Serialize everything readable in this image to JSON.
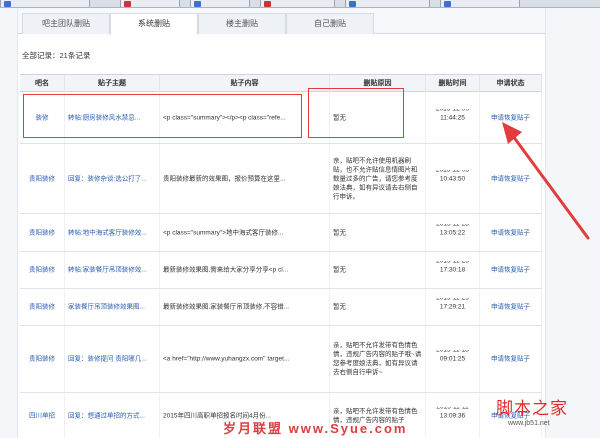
{
  "browser_tabs": [
    "",
    "",
    "",
    "",
    "",
    ""
  ],
  "subtabs": [
    "吧主团队删贴",
    "系统删贴",
    "楼主删贴",
    "自己删贴"
  ],
  "record_count": "全部记录：21条记录",
  "table": {
    "headers": [
      "吧名",
      "贴子主题",
      "贴子内容",
      "删贴原因",
      "删贴时间",
      "申请状态"
    ],
    "rows": [
      {
        "bar": "装修",
        "title": "转帖:厨房装修风水禁忌...",
        "content": "<p class=\"summary\"></p><p class=\"refe...",
        "reason": "暂无",
        "date": "2015-12-09",
        "time": "11:44:25",
        "status": "申请恢复贴子"
      },
      {
        "bar": "贵阳装修",
        "title": "回复：装修杂谈:选公打了...",
        "content": "贵阳装修最新的效果图，报价预算在这里...",
        "reason": "亲，贴吧不允许使用机器刷贴，也不允许贴信息情图片和数量过多的广告，请您参考度娘法典，如有异议请去右侧自行申诉。",
        "date": "2015-12-03",
        "time": "10:43:50",
        "status": "申请恢复贴子"
      },
      {
        "bar": "贵阳装修",
        "title": "转帖:地中海式客厅装修效...",
        "content": "<p class=\"summary\">地中海式客厅装修...",
        "reason": "暂无",
        "date": "2015-11-28",
        "time": "13:05:22",
        "status": "申请恢复贴子"
      },
      {
        "bar": "贵阳装修",
        "title": "转帖:家装餐厅吊顶装修效...",
        "content": "最新装修效果图,需来给大家分享分享<p cl...",
        "reason": "暂无",
        "date": "2015-11-25",
        "time": "17:30:18",
        "status": "申请恢复贴子"
      },
      {
        "bar": "贵阳装修",
        "title": "家装餐厅吊顶装修效果图...",
        "content": "最新装修效果图,家装餐厅吊顶装修,不容错...",
        "reason": "暂无",
        "date": "2015-11-25",
        "time": "17:29:21",
        "status": "申请恢复贴子"
      },
      {
        "bar": "贵阳装修",
        "title": "回复：装修提问 贵阳哪几...",
        "content": "<a href=\"http://www.yuhangzx.com\" target...",
        "reason": "亲，贴吧不允许发带有色情色情，违规广告内容的贴子哦~请您参考度娘法典，如有异议请去右侧自行申诉~",
        "date": "2015-11-18",
        "time": "09:01:25",
        "status": "申请恢复贴子"
      },
      {
        "bar": "四川单招",
        "title": "回复：想通过单招的方式...",
        "content": "2015年四川高职单招报名时间4月份...",
        "reason": "亲，贴吧不允许发带有色情色情，违规广告内容的贴子",
        "date": "2015-11-11",
        "time": "13:09:36",
        "status": "申请恢复贴子"
      }
    ]
  },
  "watermarks": {
    "left": "岁月联盟 www.Syue.com",
    "right": "脚本之家",
    "right_url": "www.jb51.net"
  },
  "colors": {
    "link": "#2a5db0",
    "annotation": "#e23c3c"
  }
}
